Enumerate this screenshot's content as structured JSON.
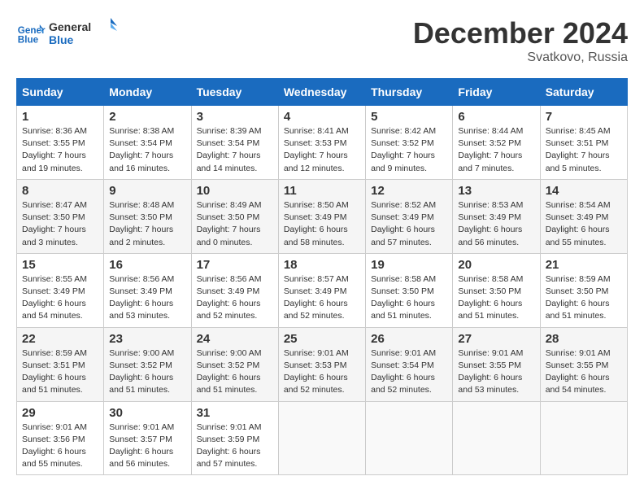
{
  "header": {
    "logo_line1": "General",
    "logo_line2": "Blue",
    "month": "December 2024",
    "location": "Svatkovo, Russia"
  },
  "weekdays": [
    "Sunday",
    "Monday",
    "Tuesday",
    "Wednesday",
    "Thursday",
    "Friday",
    "Saturday"
  ],
  "weeks": [
    [
      {
        "day": "1",
        "info": "Sunrise: 8:36 AM\nSunset: 3:55 PM\nDaylight: 7 hours\nand 19 minutes."
      },
      {
        "day": "2",
        "info": "Sunrise: 8:38 AM\nSunset: 3:54 PM\nDaylight: 7 hours\nand 16 minutes."
      },
      {
        "day": "3",
        "info": "Sunrise: 8:39 AM\nSunset: 3:54 PM\nDaylight: 7 hours\nand 14 minutes."
      },
      {
        "day": "4",
        "info": "Sunrise: 8:41 AM\nSunset: 3:53 PM\nDaylight: 7 hours\nand 12 minutes."
      },
      {
        "day": "5",
        "info": "Sunrise: 8:42 AM\nSunset: 3:52 PM\nDaylight: 7 hours\nand 9 minutes."
      },
      {
        "day": "6",
        "info": "Sunrise: 8:44 AM\nSunset: 3:52 PM\nDaylight: 7 hours\nand 7 minutes."
      },
      {
        "day": "7",
        "info": "Sunrise: 8:45 AM\nSunset: 3:51 PM\nDaylight: 7 hours\nand 5 minutes."
      }
    ],
    [
      {
        "day": "8",
        "info": "Sunrise: 8:47 AM\nSunset: 3:50 PM\nDaylight: 7 hours\nand 3 minutes."
      },
      {
        "day": "9",
        "info": "Sunrise: 8:48 AM\nSunset: 3:50 PM\nDaylight: 7 hours\nand 2 minutes."
      },
      {
        "day": "10",
        "info": "Sunrise: 8:49 AM\nSunset: 3:50 PM\nDaylight: 7 hours\nand 0 minutes."
      },
      {
        "day": "11",
        "info": "Sunrise: 8:50 AM\nSunset: 3:49 PM\nDaylight: 6 hours\nand 58 minutes."
      },
      {
        "day": "12",
        "info": "Sunrise: 8:52 AM\nSunset: 3:49 PM\nDaylight: 6 hours\nand 57 minutes."
      },
      {
        "day": "13",
        "info": "Sunrise: 8:53 AM\nSunset: 3:49 PM\nDaylight: 6 hours\nand 56 minutes."
      },
      {
        "day": "14",
        "info": "Sunrise: 8:54 AM\nSunset: 3:49 PM\nDaylight: 6 hours\nand 55 minutes."
      }
    ],
    [
      {
        "day": "15",
        "info": "Sunrise: 8:55 AM\nSunset: 3:49 PM\nDaylight: 6 hours\nand 54 minutes."
      },
      {
        "day": "16",
        "info": "Sunrise: 8:56 AM\nSunset: 3:49 PM\nDaylight: 6 hours\nand 53 minutes."
      },
      {
        "day": "17",
        "info": "Sunrise: 8:56 AM\nSunset: 3:49 PM\nDaylight: 6 hours\nand 52 minutes."
      },
      {
        "day": "18",
        "info": "Sunrise: 8:57 AM\nSunset: 3:49 PM\nDaylight: 6 hours\nand 52 minutes."
      },
      {
        "day": "19",
        "info": "Sunrise: 8:58 AM\nSunset: 3:50 PM\nDaylight: 6 hours\nand 51 minutes."
      },
      {
        "day": "20",
        "info": "Sunrise: 8:58 AM\nSunset: 3:50 PM\nDaylight: 6 hours\nand 51 minutes."
      },
      {
        "day": "21",
        "info": "Sunrise: 8:59 AM\nSunset: 3:50 PM\nDaylight: 6 hours\nand 51 minutes."
      }
    ],
    [
      {
        "day": "22",
        "info": "Sunrise: 8:59 AM\nSunset: 3:51 PM\nDaylight: 6 hours\nand 51 minutes."
      },
      {
        "day": "23",
        "info": "Sunrise: 9:00 AM\nSunset: 3:52 PM\nDaylight: 6 hours\nand 51 minutes."
      },
      {
        "day": "24",
        "info": "Sunrise: 9:00 AM\nSunset: 3:52 PM\nDaylight: 6 hours\nand 51 minutes."
      },
      {
        "day": "25",
        "info": "Sunrise: 9:01 AM\nSunset: 3:53 PM\nDaylight: 6 hours\nand 52 minutes."
      },
      {
        "day": "26",
        "info": "Sunrise: 9:01 AM\nSunset: 3:54 PM\nDaylight: 6 hours\nand 52 minutes."
      },
      {
        "day": "27",
        "info": "Sunrise: 9:01 AM\nSunset: 3:55 PM\nDaylight: 6 hours\nand 53 minutes."
      },
      {
        "day": "28",
        "info": "Sunrise: 9:01 AM\nSunset: 3:55 PM\nDaylight: 6 hours\nand 54 minutes."
      }
    ],
    [
      {
        "day": "29",
        "info": "Sunrise: 9:01 AM\nSunset: 3:56 PM\nDaylight: 6 hours\nand 55 minutes."
      },
      {
        "day": "30",
        "info": "Sunrise: 9:01 AM\nSunset: 3:57 PM\nDaylight: 6 hours\nand 56 minutes."
      },
      {
        "day": "31",
        "info": "Sunrise: 9:01 AM\nSunset: 3:59 PM\nDaylight: 6 hours\nand 57 minutes."
      },
      null,
      null,
      null,
      null
    ]
  ]
}
